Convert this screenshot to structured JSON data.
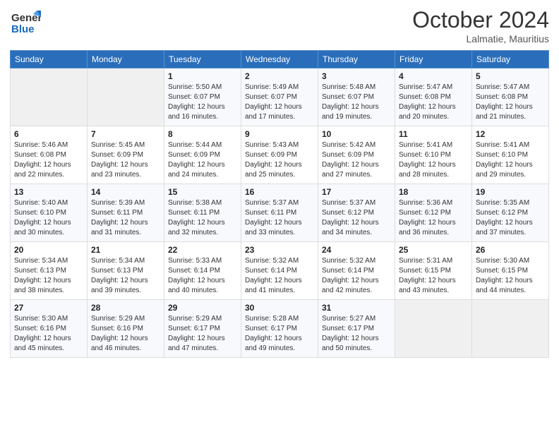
{
  "header": {
    "logo_line1": "General",
    "logo_line2": "Blue",
    "month": "October 2024",
    "location": "Lalmatie, Mauritius"
  },
  "weekdays": [
    "Sunday",
    "Monday",
    "Tuesday",
    "Wednesday",
    "Thursday",
    "Friday",
    "Saturday"
  ],
  "weeks": [
    [
      {
        "day": "",
        "info": ""
      },
      {
        "day": "",
        "info": ""
      },
      {
        "day": "1",
        "info": "Sunrise: 5:50 AM\nSunset: 6:07 PM\nDaylight: 12 hours and 16 minutes."
      },
      {
        "day": "2",
        "info": "Sunrise: 5:49 AM\nSunset: 6:07 PM\nDaylight: 12 hours and 17 minutes."
      },
      {
        "day": "3",
        "info": "Sunrise: 5:48 AM\nSunset: 6:07 PM\nDaylight: 12 hours and 19 minutes."
      },
      {
        "day": "4",
        "info": "Sunrise: 5:47 AM\nSunset: 6:08 PM\nDaylight: 12 hours and 20 minutes."
      },
      {
        "day": "5",
        "info": "Sunrise: 5:47 AM\nSunset: 6:08 PM\nDaylight: 12 hours and 21 minutes."
      }
    ],
    [
      {
        "day": "6",
        "info": "Sunrise: 5:46 AM\nSunset: 6:08 PM\nDaylight: 12 hours and 22 minutes."
      },
      {
        "day": "7",
        "info": "Sunrise: 5:45 AM\nSunset: 6:09 PM\nDaylight: 12 hours and 23 minutes."
      },
      {
        "day": "8",
        "info": "Sunrise: 5:44 AM\nSunset: 6:09 PM\nDaylight: 12 hours and 24 minutes."
      },
      {
        "day": "9",
        "info": "Sunrise: 5:43 AM\nSunset: 6:09 PM\nDaylight: 12 hours and 25 minutes."
      },
      {
        "day": "10",
        "info": "Sunrise: 5:42 AM\nSunset: 6:09 PM\nDaylight: 12 hours and 27 minutes."
      },
      {
        "day": "11",
        "info": "Sunrise: 5:41 AM\nSunset: 6:10 PM\nDaylight: 12 hours and 28 minutes."
      },
      {
        "day": "12",
        "info": "Sunrise: 5:41 AM\nSunset: 6:10 PM\nDaylight: 12 hours and 29 minutes."
      }
    ],
    [
      {
        "day": "13",
        "info": "Sunrise: 5:40 AM\nSunset: 6:10 PM\nDaylight: 12 hours and 30 minutes."
      },
      {
        "day": "14",
        "info": "Sunrise: 5:39 AM\nSunset: 6:11 PM\nDaylight: 12 hours and 31 minutes."
      },
      {
        "day": "15",
        "info": "Sunrise: 5:38 AM\nSunset: 6:11 PM\nDaylight: 12 hours and 32 minutes."
      },
      {
        "day": "16",
        "info": "Sunrise: 5:37 AM\nSunset: 6:11 PM\nDaylight: 12 hours and 33 minutes."
      },
      {
        "day": "17",
        "info": "Sunrise: 5:37 AM\nSunset: 6:12 PM\nDaylight: 12 hours and 34 minutes."
      },
      {
        "day": "18",
        "info": "Sunrise: 5:36 AM\nSunset: 6:12 PM\nDaylight: 12 hours and 36 minutes."
      },
      {
        "day": "19",
        "info": "Sunrise: 5:35 AM\nSunset: 6:12 PM\nDaylight: 12 hours and 37 minutes."
      }
    ],
    [
      {
        "day": "20",
        "info": "Sunrise: 5:34 AM\nSunset: 6:13 PM\nDaylight: 12 hours and 38 minutes."
      },
      {
        "day": "21",
        "info": "Sunrise: 5:34 AM\nSunset: 6:13 PM\nDaylight: 12 hours and 39 minutes."
      },
      {
        "day": "22",
        "info": "Sunrise: 5:33 AM\nSunset: 6:14 PM\nDaylight: 12 hours and 40 minutes."
      },
      {
        "day": "23",
        "info": "Sunrise: 5:32 AM\nSunset: 6:14 PM\nDaylight: 12 hours and 41 minutes."
      },
      {
        "day": "24",
        "info": "Sunrise: 5:32 AM\nSunset: 6:14 PM\nDaylight: 12 hours and 42 minutes."
      },
      {
        "day": "25",
        "info": "Sunrise: 5:31 AM\nSunset: 6:15 PM\nDaylight: 12 hours and 43 minutes."
      },
      {
        "day": "26",
        "info": "Sunrise: 5:30 AM\nSunset: 6:15 PM\nDaylight: 12 hours and 44 minutes."
      }
    ],
    [
      {
        "day": "27",
        "info": "Sunrise: 5:30 AM\nSunset: 6:16 PM\nDaylight: 12 hours and 45 minutes."
      },
      {
        "day": "28",
        "info": "Sunrise: 5:29 AM\nSunset: 6:16 PM\nDaylight: 12 hours and 46 minutes."
      },
      {
        "day": "29",
        "info": "Sunrise: 5:29 AM\nSunset: 6:17 PM\nDaylight: 12 hours and 47 minutes."
      },
      {
        "day": "30",
        "info": "Sunrise: 5:28 AM\nSunset: 6:17 PM\nDaylight: 12 hours and 49 minutes."
      },
      {
        "day": "31",
        "info": "Sunrise: 5:27 AM\nSunset: 6:17 PM\nDaylight: 12 hours and 50 minutes."
      },
      {
        "day": "",
        "info": ""
      },
      {
        "day": "",
        "info": ""
      }
    ]
  ]
}
